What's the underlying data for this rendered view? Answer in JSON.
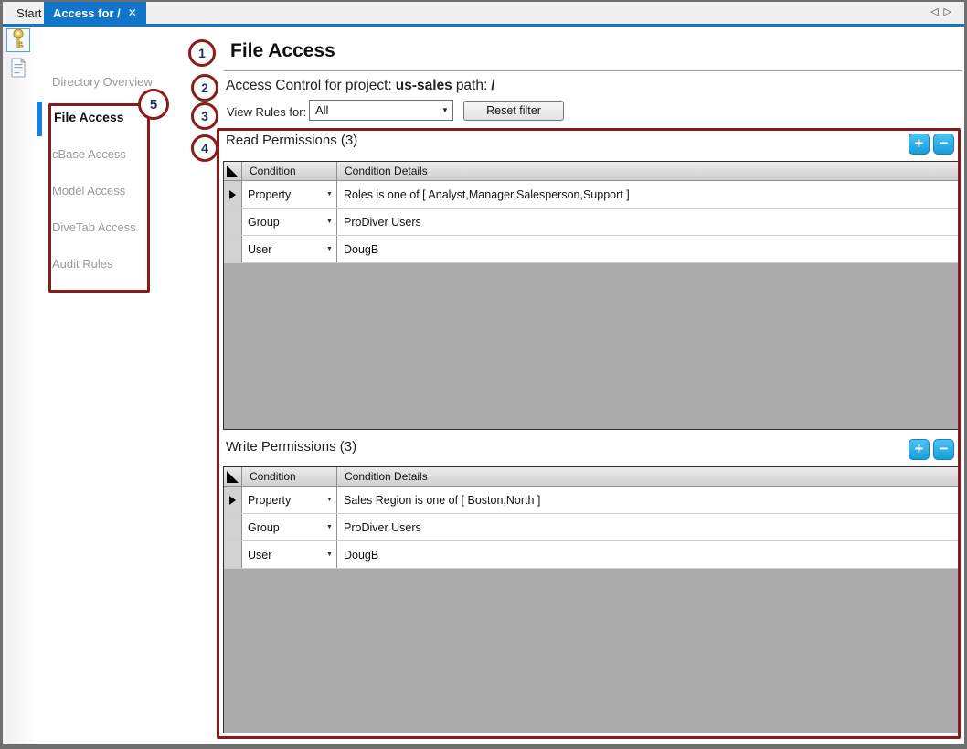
{
  "tabbar": {
    "start_tab": "Start",
    "active_tab": "Access for /",
    "close": "✕",
    "arrow_left": "◁",
    "arrow_right": "▷"
  },
  "sidebar": {
    "items": [
      {
        "label": "Directory Overview"
      },
      {
        "label": "File Access"
      },
      {
        "label": "cBase Access"
      },
      {
        "label": "Model Access"
      },
      {
        "label": "DiveTab Access"
      },
      {
        "label": "Audit Rules"
      }
    ],
    "selected": "File Access",
    "icons": [
      "key-icon",
      "document-icon"
    ]
  },
  "header": {
    "title": "File Access",
    "access_prefix": "Access Control for project:",
    "project": "us-sales",
    "path_label": "path:",
    "path": "/",
    "filter_label": "View Rules for:",
    "filter_value": "All",
    "reset_button": "Reset filter"
  },
  "read": {
    "title": "Read Permissions (3)",
    "col_condition": "Condition",
    "col_details": "Condition Details",
    "rows": [
      {
        "condition": "Property",
        "details": "Roles is one of [ Analyst,Manager,Salesperson,Support ]"
      },
      {
        "condition": "Group",
        "details": "ProDiver Users"
      },
      {
        "condition": "User",
        "details": "DougB"
      }
    ]
  },
  "write": {
    "title": "Write Permissions (3)",
    "col_condition": "Condition",
    "col_details": "Condition Details",
    "rows": [
      {
        "condition": "Property",
        "details": "Sales Region is one of [ Boston,North ]"
      },
      {
        "condition": "Group",
        "details": "ProDiver Users"
      },
      {
        "condition": "User",
        "details": "DougB"
      }
    ]
  },
  "buttons": {
    "add": "+",
    "remove": "−"
  },
  "callouts": {
    "c1": "1",
    "c2": "2",
    "c3": "3",
    "c4": "4",
    "c5": "5"
  },
  "colors": {
    "accent_blue": "#0f76cc",
    "button_blue": "#29abe2",
    "annotation_red": "#8b1a1a",
    "grid_gray": "#ababab"
  }
}
